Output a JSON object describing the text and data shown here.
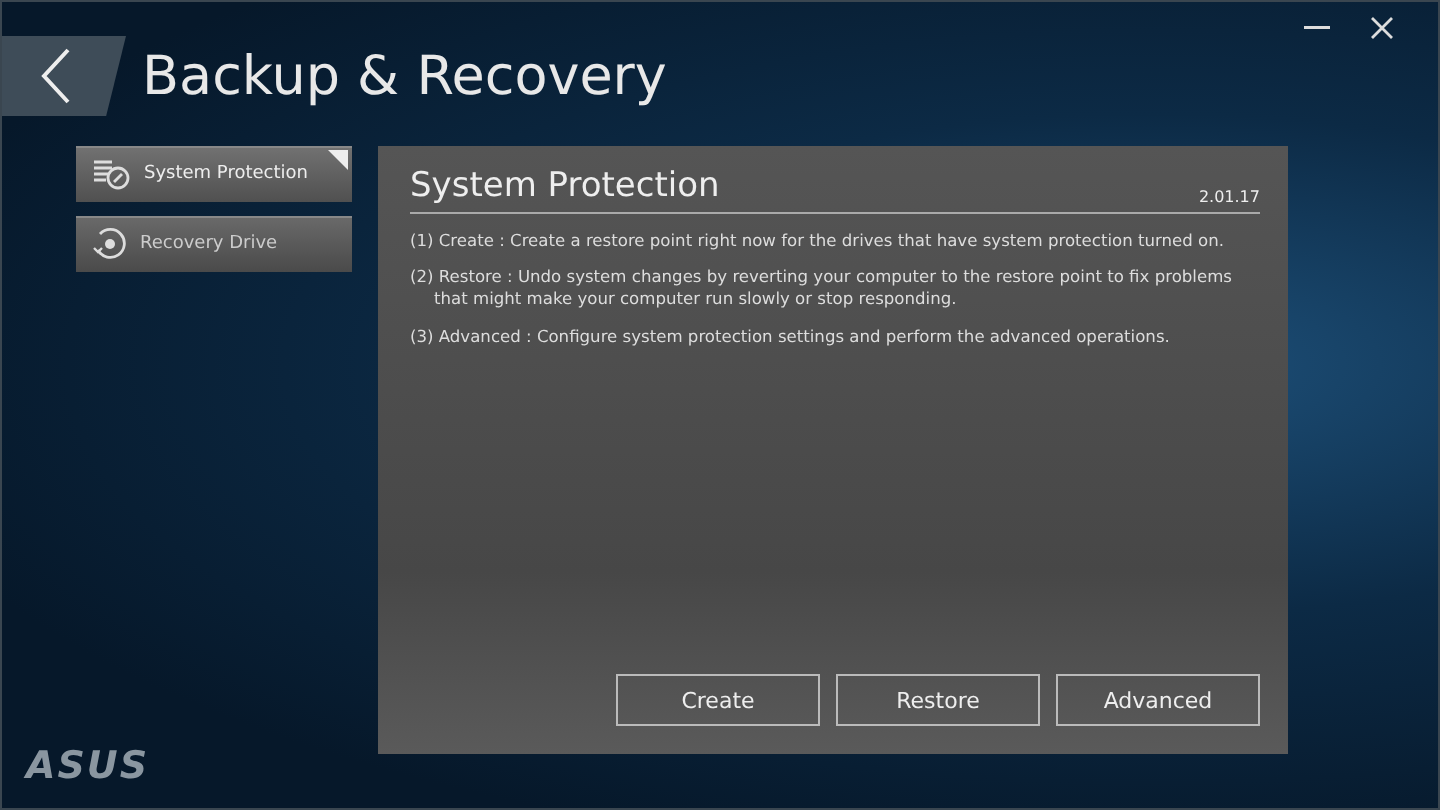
{
  "window": {
    "title": "Backup & Recovery",
    "logo": "ASUS"
  },
  "sidebar": {
    "items": [
      {
        "label": "System Protection",
        "kind": "protection",
        "selected": true
      },
      {
        "label": "Recovery Drive",
        "kind": "recovery",
        "selected": false
      }
    ]
  },
  "panel": {
    "title": "System Protection",
    "version": "2.01.17",
    "descriptions": [
      "(1) Create : Create a restore point right now for the drives that have system protection turned on.",
      "(2) Restore : Undo system changes by reverting  your computer to the restore point to fix problems that might make your computer run slowly or stop responding.",
      "(3) Advanced : Configure system protection settings and perform the advanced operations."
    ],
    "buttons": [
      "Create",
      "Restore",
      "Advanced"
    ]
  }
}
